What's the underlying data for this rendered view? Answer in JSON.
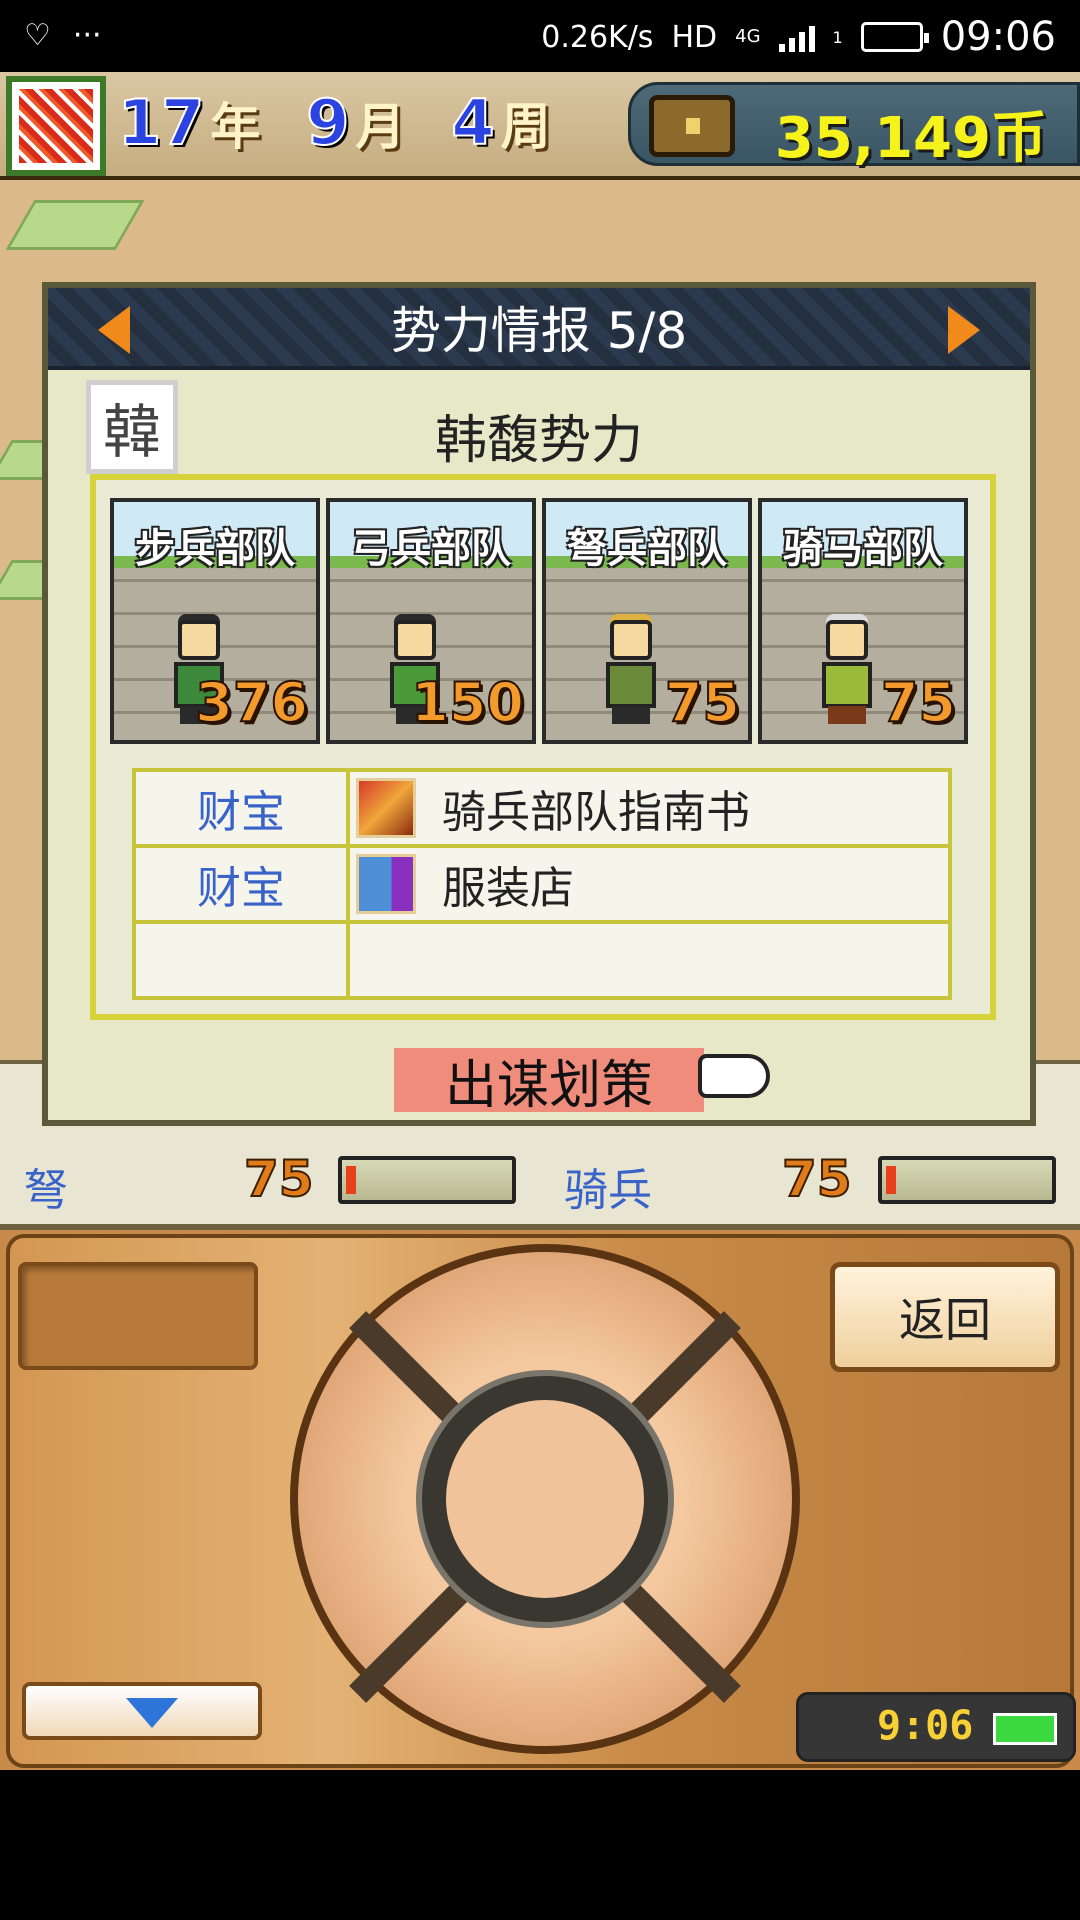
{
  "status_bar": {
    "net_speed": "0.26K/s",
    "hd": "HD",
    "network": "4G",
    "sim": "1",
    "time": "09:06",
    "dots": "···",
    "heart_icon": "heart-pulse-icon"
  },
  "header": {
    "year_num": "17",
    "year_unit": "年",
    "month_num": "9",
    "month_unit": "月",
    "week_num": "4",
    "week_unit": "周",
    "money": "35,149币"
  },
  "dialog": {
    "title": "势力情报 5/8",
    "faction_char": "韓",
    "faction_name": "韩馥势力",
    "units": [
      {
        "name": "步兵部队",
        "count": "376"
      },
      {
        "name": "弓兵部队",
        "count": "150"
      },
      {
        "name": "弩兵部队",
        "count": "75"
      },
      {
        "name": "骑马部队",
        "count": "75"
      }
    ],
    "treasures": [
      {
        "category": "财宝",
        "item": "骑兵部队指南书",
        "icon": "book-icon"
      },
      {
        "category": "财宝",
        "item": "服装店",
        "icon": "shop-icon"
      },
      {
        "category": "",
        "item": "",
        "icon": ""
      }
    ],
    "strategy_button": "出谋划策"
  },
  "background_stats": {
    "crossbow_label": "弩",
    "crossbow_value": "75",
    "cavalry_label": "骑兵",
    "cavalry_value": "75"
  },
  "controller": {
    "back_label": "返回",
    "clock": "9:06"
  },
  "colors": {
    "accent_blue": "#3a63c9",
    "count_orange": "#f39a2c",
    "money_yellow": "#f6f31a",
    "button_salmon": "#f08c7c",
    "frame_yellow": "#d6d33a"
  }
}
